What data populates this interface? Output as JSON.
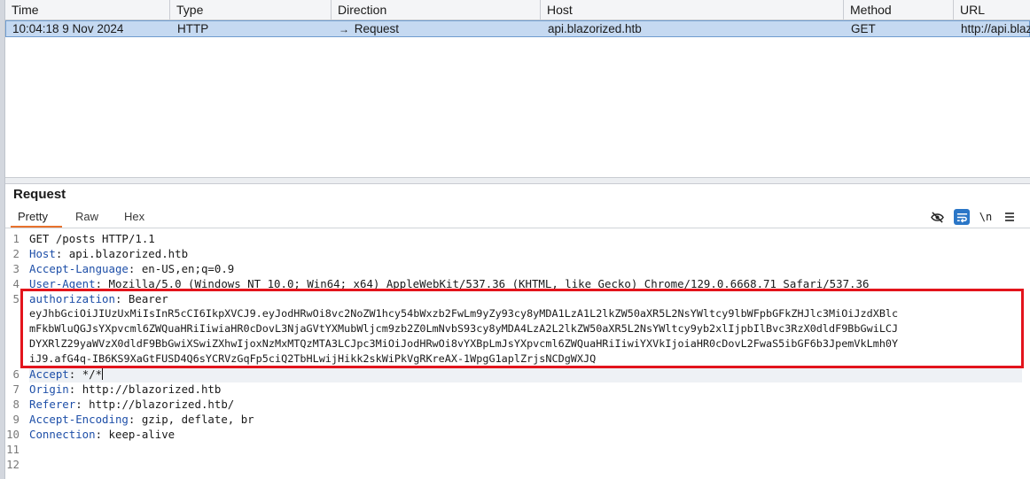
{
  "table": {
    "headers": [
      "Time",
      "Type",
      "Direction",
      "Host",
      "Method",
      "URL"
    ],
    "row": {
      "time": "10:04:18 9 Nov 2024",
      "type": "HTTP",
      "direction": "Request",
      "host": "api.blazorized.htb",
      "method": "GET",
      "url": "http://api.blazo"
    }
  },
  "panel": {
    "title": "Request",
    "tabs": [
      "Pretty",
      "Raw",
      "Hex"
    ],
    "active_tab": "Pretty",
    "tools": {
      "newline_label": "\\n"
    }
  },
  "editor": {
    "line_numbers": [
      "1",
      "2",
      "3",
      "4",
      "5",
      "6",
      "7",
      "8",
      "9",
      "10",
      "11",
      "12"
    ],
    "request_line": "GET /posts HTTP/1.1",
    "headers": [
      {
        "key": "Host",
        "sep": ": ",
        "value": "api.blazorized.htb"
      },
      {
        "key": "Accept-Language",
        "sep": ": ",
        "value": "en-US,en;q=0.9"
      },
      {
        "key": "User-Agent",
        "sep": ": ",
        "value": "Mozilla/5.0 (Windows NT 10.0; Win64; x64) AppleWebKit/537.36 (KHTML, like Gecko) Chrome/129.0.6668.71 Safari/537.36"
      },
      {
        "key": "authorization",
        "sep": ": ",
        "value": "Bearer"
      }
    ],
    "token_lines": [
      "eyJhbGciOiJIUzUxMiIsInR5cCI6IkpXVCJ9.eyJodHRwOi8vc2NoZW1hcy54bWxzb2FwLm9yZy93cy8yMDA1LzA1L2lkZW50aXR5L2NsYWltcy9lbWFpbGFkZHJlc3MiOiJzdXBlc",
      "mFkbWluQGJsYXpvcml6ZWQuaHRiIiwiaHR0cDovL3NjaGVtYXMubWljcm9zb2Z0LmNvbS93cy8yMDA4LzA2L2lkZW50aXR5L2NsYWltcy9yb2xlIjpbIlBvc3RzX0dldF9BbGwiLCJ",
      "DYXRlZ29yaWVzX0dldF9BbGwiXSwiZXhwIjoxNzMxMTQzMTA3LCJpc3MiOiJodHRwOi8vYXBpLmJsYXpvcml6ZWQuaHRiIiwiYXVkIjoiaHR0cDovL2FwaS5ibGF6b3JpemVkLmh0Y",
      "iJ9.afG4q-IB6KS9XaGtFUSD4Q6sYCRVzGqFp5ciQ2TbHLwijHikk2skWiPkVgRKreAX-1WpgG1aplZrjsNCDgWXJQ"
    ],
    "headers_after": [
      {
        "key": "Accept",
        "sep": ": ",
        "value": "*/*"
      },
      {
        "key": "Origin",
        "sep": ": ",
        "value": "http://blazorized.htb"
      },
      {
        "key": "Referer",
        "sep": ": ",
        "value": "http://blazorized.htb/"
      },
      {
        "key": "Accept-Encoding",
        "sep": ": ",
        "value": "gzip, deflate, br"
      },
      {
        "key": "Connection",
        "sep": ": ",
        "value": "keep-alive"
      }
    ]
  },
  "colors": {
    "selection": "#c5d9f1",
    "highlight_border": "#e3141c",
    "header_key": "#1e4fa8",
    "active_tab_accent": "#e8722c"
  }
}
